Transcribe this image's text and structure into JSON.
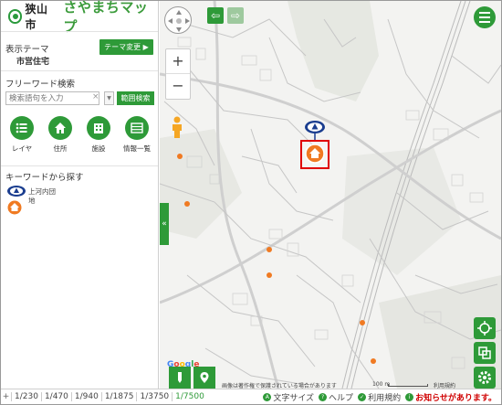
{
  "header": {
    "city": "狭山市",
    "app_name": "さやまちマップ"
  },
  "theme": {
    "label": "表示テーマ",
    "change_button": "テーマ変更 ▶",
    "current": "市営住宅"
  },
  "search": {
    "label": "フリーワード検索",
    "placeholder": "検索語句を入力",
    "clear": "×",
    "dropdown": "▼",
    "range_button": "範囲検索"
  },
  "menu": [
    {
      "label": "レイヤ",
      "icon": "list-icon"
    },
    {
      "label": "住所",
      "icon": "house-icon"
    },
    {
      "label": "施設",
      "icon": "building-icon"
    },
    {
      "label": "情報一覧",
      "icon": "table-icon"
    }
  ],
  "keyword": {
    "title": "キーワードから探す",
    "item1": "上河内団",
    "item2": "地"
  },
  "collapse": "«",
  "map": {
    "attribution": "画像は著作権で保護されている場合があります",
    "scale": "100 m",
    "terms": "利用規約",
    "google": [
      "G",
      "o",
      "o",
      "g",
      "l",
      "e"
    ],
    "google_colors": [
      "#4285f4",
      "#ea4335",
      "#fbbc05",
      "#4285f4",
      "#34a853",
      "#ea4335"
    ]
  },
  "footer": {
    "plus": "+",
    "scales": [
      "1/230",
      "1/470",
      "1/940",
      "1/1875",
      "1/3750",
      "1/7500"
    ],
    "active_scale": "1/7500",
    "links": [
      "文字サイズ",
      "ヘルプ",
      "利用規約"
    ],
    "notice": "お知らせがあります。"
  },
  "colors": {
    "accent": "#2e9a38",
    "marker_orange": "#f07a22",
    "marker_blue": "#1a3d8f",
    "alert": "#d00000"
  }
}
